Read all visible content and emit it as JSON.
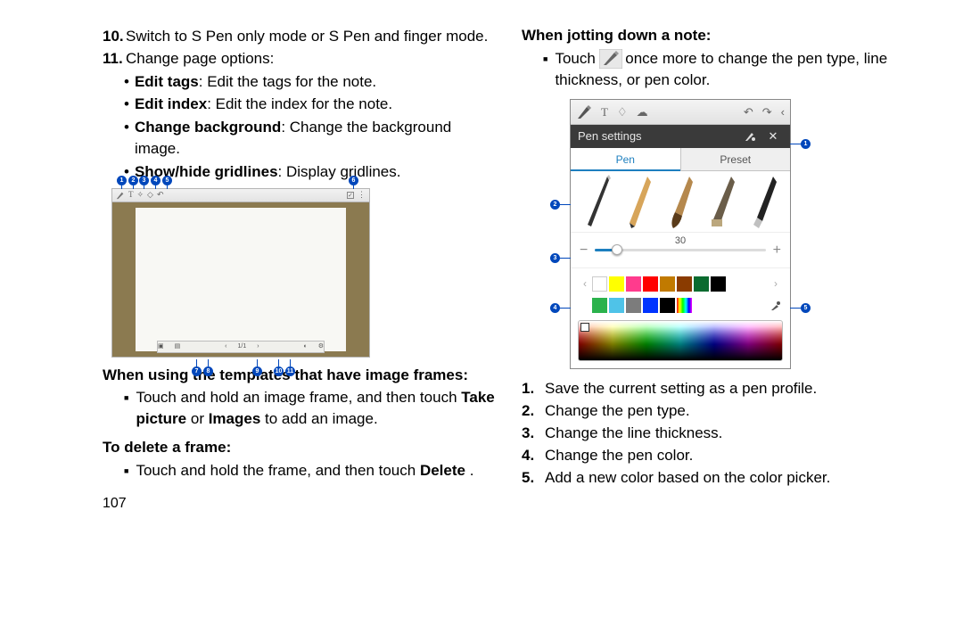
{
  "left": {
    "item10": {
      "num": "10.",
      "text": "Switch to S Pen only mode or S Pen and finger mode."
    },
    "item11": {
      "num": "11.",
      "text": "Change page options:"
    },
    "sub": {
      "a": {
        "b": "Edit tags",
        "t": ": Edit the tags for the note."
      },
      "b": {
        "b": "Edit index",
        "t": ": Edit the index for the note."
      },
      "c": {
        "b": "Change background",
        "t": ": Change the background image."
      },
      "d": {
        "b": "Show/hide gridlines",
        "t": ": Display gridlines."
      }
    },
    "h_templates": "When using the templates that have image frames:",
    "templates_text_pre": "Touch and hold an image frame, and then touch ",
    "templates_b1": "Take picture",
    "templates_or": " or ",
    "templates_b2": "Images",
    "templates_text_post": " to add an image.",
    "h_delete": "To delete a frame:",
    "delete_text_pre": "Touch and hold the frame, and then touch ",
    "delete_b": "Delete",
    "delete_text_post": ".",
    "page_num": "107",
    "fig1_bottom_page": "1/1"
  },
  "right": {
    "h_jot": "When jotting down a note:",
    "jot_pre": "Touch ",
    "jot_post": " once more to change the pen type, line thickness, or pen color.",
    "ps_title": "Pen settings",
    "tab_pen": "Pen",
    "tab_preset": "Preset",
    "thickness": "30",
    "steps": {
      "n1": {
        "num": "1.",
        "t": "Save the current setting as a pen profile."
      },
      "n2": {
        "num": "2.",
        "t": "Change the pen type."
      },
      "n3": {
        "num": "3.",
        "t": "Change the line thickness."
      },
      "n4": {
        "num": "4.",
        "t": "Change the pen color."
      },
      "n5": {
        "num": "5.",
        "t": "Add a new color based on the color picker."
      }
    }
  },
  "swatches": {
    "r1": [
      "#ffffff",
      "#ffff00",
      "#ff3b8d",
      "#ff0000",
      "#c17a00",
      "#8a3b00",
      "#0a6b2f",
      "#000000"
    ],
    "r2": [
      "#2bb24c",
      "#4fc3e8",
      "#7c7c7c",
      "#0033ff",
      "#000000",
      "#ff0000|#ffff00|#00ff00|#00ffff|#0000ff|#ff00ff"
    ]
  }
}
